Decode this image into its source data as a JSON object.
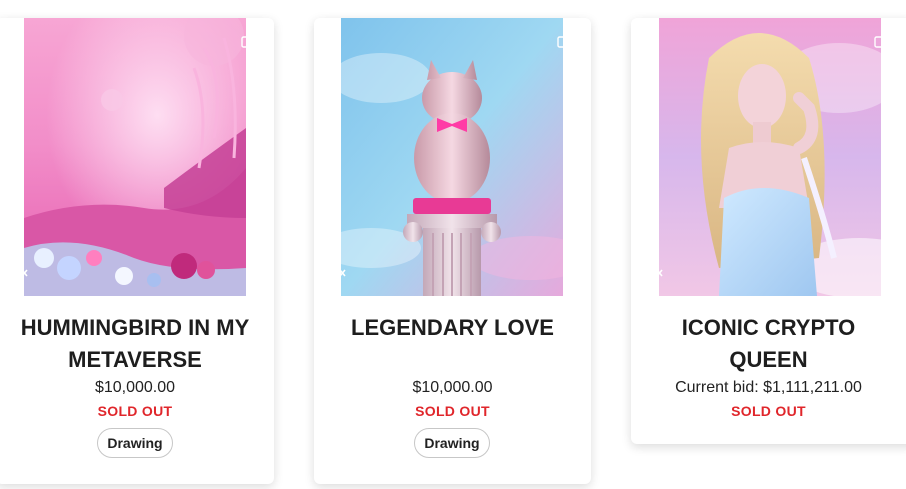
{
  "products": [
    {
      "title": "HUMMINGBIRD IN MY METAVERSE",
      "price": "$10,000.00",
      "status": "SOLD OUT",
      "tag": "Drawing",
      "media_icons": [
        "video-camera-off-icon",
        "muted-speaker-icon"
      ]
    },
    {
      "title": "LEGENDARY LOVE",
      "price": "$10,000.00",
      "status": "SOLD OUT",
      "tag": "Drawing",
      "media_icons": [
        "video-camera-off-icon",
        "muted-speaker-icon"
      ]
    },
    {
      "title": "ICONIC CRYPTO QUEEN",
      "price": "Current bid: $1,111,211.00",
      "status": "SOLD OUT",
      "media_icons": [
        "video-camera-off-icon",
        "muted-speaker-icon"
      ]
    }
  ],
  "colors": {
    "status_red": "#e0262b",
    "title_text": "#1e1e1e",
    "tag_border": "#c7c7c7"
  }
}
